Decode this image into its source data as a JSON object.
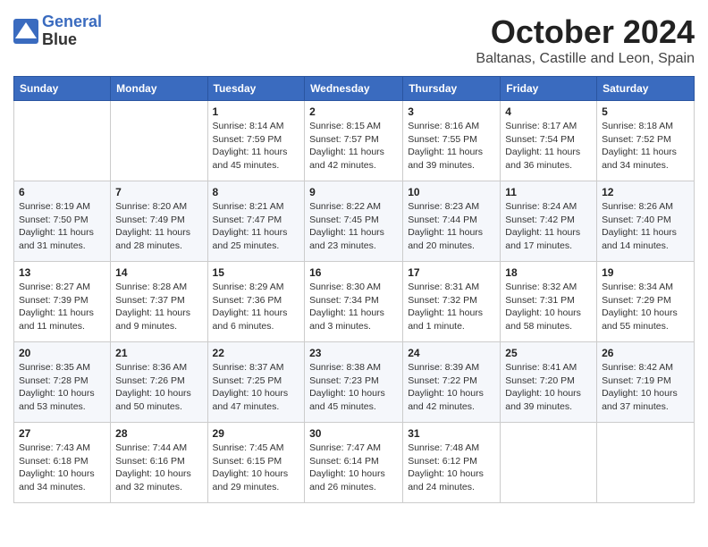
{
  "header": {
    "logo_line1": "General",
    "logo_line2": "Blue",
    "month_title": "October 2024",
    "location": "Baltanas, Castille and Leon, Spain"
  },
  "weekdays": [
    "Sunday",
    "Monday",
    "Tuesday",
    "Wednesday",
    "Thursday",
    "Friday",
    "Saturday"
  ],
  "weeks": [
    [
      {
        "day": "",
        "info": ""
      },
      {
        "day": "",
        "info": ""
      },
      {
        "day": "1",
        "info": "Sunrise: 8:14 AM\nSunset: 7:59 PM\nDaylight: 11 hours and 45 minutes."
      },
      {
        "day": "2",
        "info": "Sunrise: 8:15 AM\nSunset: 7:57 PM\nDaylight: 11 hours and 42 minutes."
      },
      {
        "day": "3",
        "info": "Sunrise: 8:16 AM\nSunset: 7:55 PM\nDaylight: 11 hours and 39 minutes."
      },
      {
        "day": "4",
        "info": "Sunrise: 8:17 AM\nSunset: 7:54 PM\nDaylight: 11 hours and 36 minutes."
      },
      {
        "day": "5",
        "info": "Sunrise: 8:18 AM\nSunset: 7:52 PM\nDaylight: 11 hours and 34 minutes."
      }
    ],
    [
      {
        "day": "6",
        "info": "Sunrise: 8:19 AM\nSunset: 7:50 PM\nDaylight: 11 hours and 31 minutes."
      },
      {
        "day": "7",
        "info": "Sunrise: 8:20 AM\nSunset: 7:49 PM\nDaylight: 11 hours and 28 minutes."
      },
      {
        "day": "8",
        "info": "Sunrise: 8:21 AM\nSunset: 7:47 PM\nDaylight: 11 hours and 25 minutes."
      },
      {
        "day": "9",
        "info": "Sunrise: 8:22 AM\nSunset: 7:45 PM\nDaylight: 11 hours and 23 minutes."
      },
      {
        "day": "10",
        "info": "Sunrise: 8:23 AM\nSunset: 7:44 PM\nDaylight: 11 hours and 20 minutes."
      },
      {
        "day": "11",
        "info": "Sunrise: 8:24 AM\nSunset: 7:42 PM\nDaylight: 11 hours and 17 minutes."
      },
      {
        "day": "12",
        "info": "Sunrise: 8:26 AM\nSunset: 7:40 PM\nDaylight: 11 hours and 14 minutes."
      }
    ],
    [
      {
        "day": "13",
        "info": "Sunrise: 8:27 AM\nSunset: 7:39 PM\nDaylight: 11 hours and 11 minutes."
      },
      {
        "day": "14",
        "info": "Sunrise: 8:28 AM\nSunset: 7:37 PM\nDaylight: 11 hours and 9 minutes."
      },
      {
        "day": "15",
        "info": "Sunrise: 8:29 AM\nSunset: 7:36 PM\nDaylight: 11 hours and 6 minutes."
      },
      {
        "day": "16",
        "info": "Sunrise: 8:30 AM\nSunset: 7:34 PM\nDaylight: 11 hours and 3 minutes."
      },
      {
        "day": "17",
        "info": "Sunrise: 8:31 AM\nSunset: 7:32 PM\nDaylight: 11 hours and 1 minute."
      },
      {
        "day": "18",
        "info": "Sunrise: 8:32 AM\nSunset: 7:31 PM\nDaylight: 10 hours and 58 minutes."
      },
      {
        "day": "19",
        "info": "Sunrise: 8:34 AM\nSunset: 7:29 PM\nDaylight: 10 hours and 55 minutes."
      }
    ],
    [
      {
        "day": "20",
        "info": "Sunrise: 8:35 AM\nSunset: 7:28 PM\nDaylight: 10 hours and 53 minutes."
      },
      {
        "day": "21",
        "info": "Sunrise: 8:36 AM\nSunset: 7:26 PM\nDaylight: 10 hours and 50 minutes."
      },
      {
        "day": "22",
        "info": "Sunrise: 8:37 AM\nSunset: 7:25 PM\nDaylight: 10 hours and 47 minutes."
      },
      {
        "day": "23",
        "info": "Sunrise: 8:38 AM\nSunset: 7:23 PM\nDaylight: 10 hours and 45 minutes."
      },
      {
        "day": "24",
        "info": "Sunrise: 8:39 AM\nSunset: 7:22 PM\nDaylight: 10 hours and 42 minutes."
      },
      {
        "day": "25",
        "info": "Sunrise: 8:41 AM\nSunset: 7:20 PM\nDaylight: 10 hours and 39 minutes."
      },
      {
        "day": "26",
        "info": "Sunrise: 8:42 AM\nSunset: 7:19 PM\nDaylight: 10 hours and 37 minutes."
      }
    ],
    [
      {
        "day": "27",
        "info": "Sunrise: 7:43 AM\nSunset: 6:18 PM\nDaylight: 10 hours and 34 minutes."
      },
      {
        "day": "28",
        "info": "Sunrise: 7:44 AM\nSunset: 6:16 PM\nDaylight: 10 hours and 32 minutes."
      },
      {
        "day": "29",
        "info": "Sunrise: 7:45 AM\nSunset: 6:15 PM\nDaylight: 10 hours and 29 minutes."
      },
      {
        "day": "30",
        "info": "Sunrise: 7:47 AM\nSunset: 6:14 PM\nDaylight: 10 hours and 26 minutes."
      },
      {
        "day": "31",
        "info": "Sunrise: 7:48 AM\nSunset: 6:12 PM\nDaylight: 10 hours and 24 minutes."
      },
      {
        "day": "",
        "info": ""
      },
      {
        "day": "",
        "info": ""
      }
    ]
  ]
}
